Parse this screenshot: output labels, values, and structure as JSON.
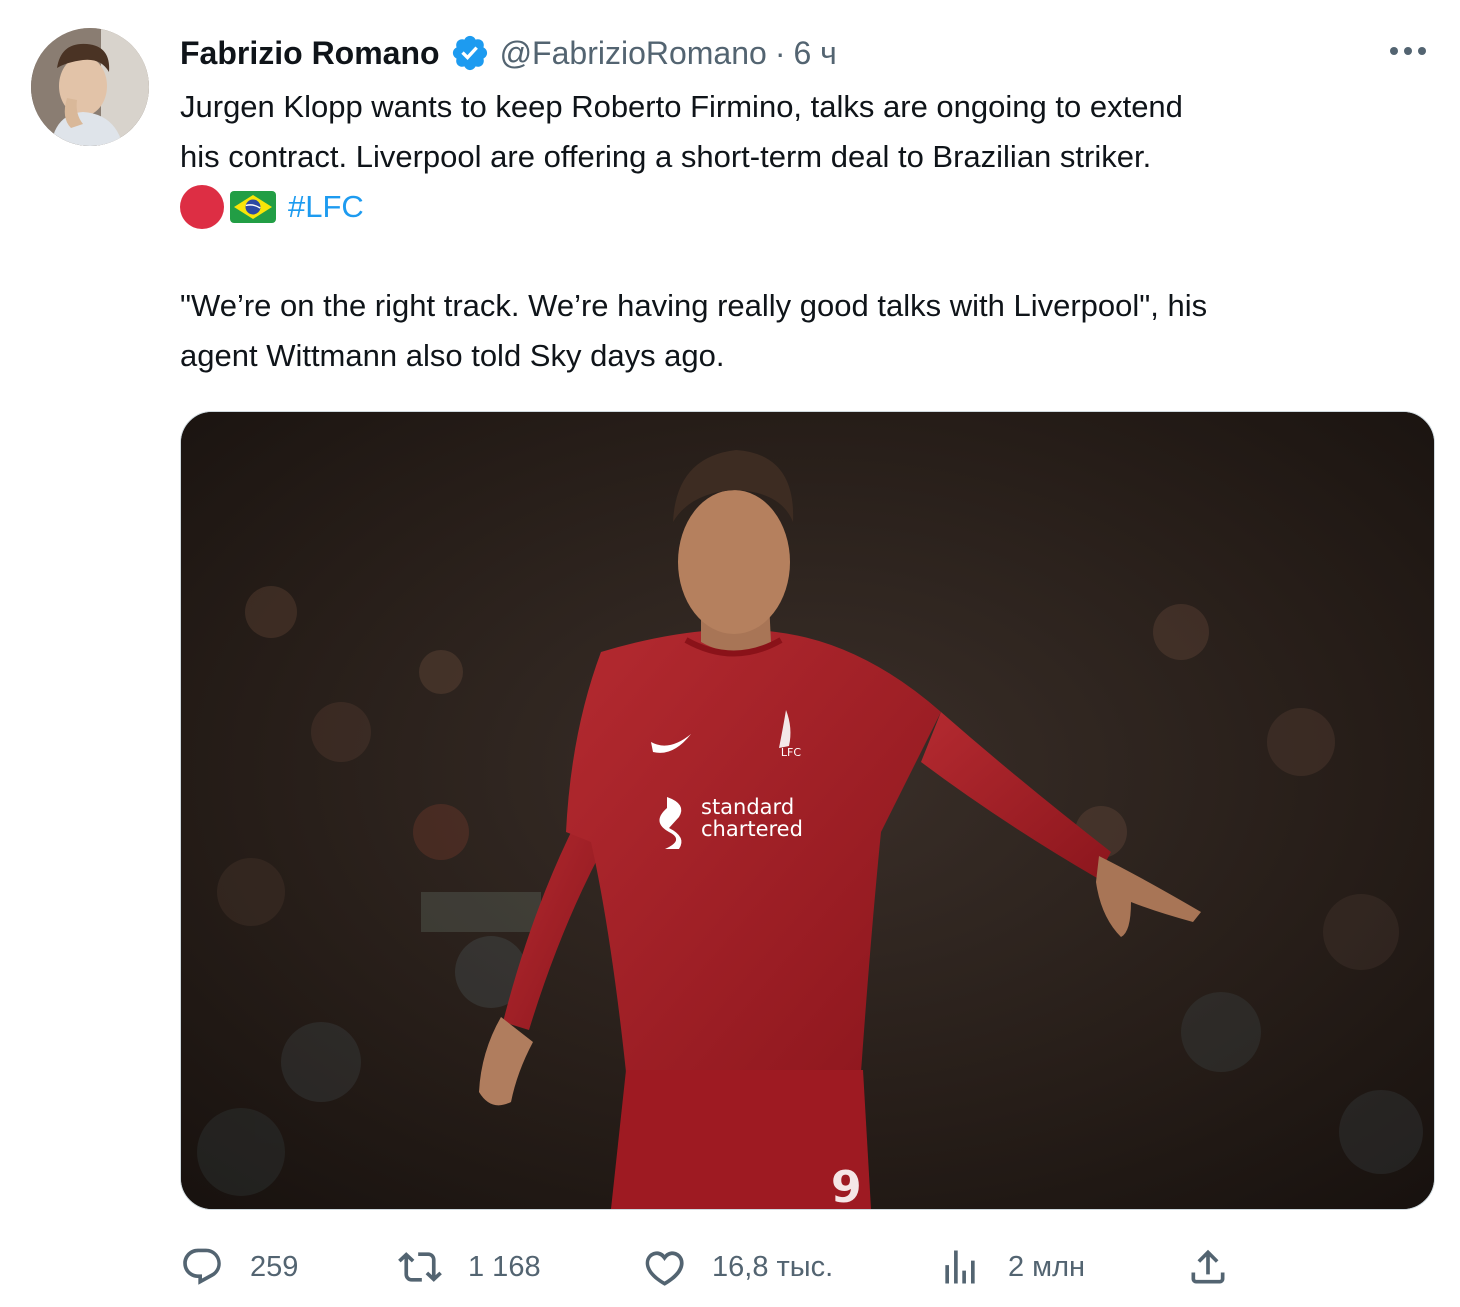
{
  "author": {
    "name": "Fabrizio Romano",
    "handle": "@FabrizioRomano",
    "separator": "·",
    "time": "6 ч"
  },
  "icons": {
    "verified": "verified-badge-icon",
    "more": "more-horizontal-icon",
    "reply": "reply-icon",
    "retweet": "retweet-icon",
    "like": "heart-icon",
    "views": "views-chart-icon",
    "share": "share-icon"
  },
  "tweet": {
    "line1": "Jurgen Klopp wants to keep Roberto Firmino, talks are ongoing to extend",
    "line2": "his contract. Liverpool are offering a short-term deal to Brazilian striker.",
    "hashtag": "#LFC",
    "quote_line1": "\"We’re on the right track. We’re having really good talks with Liverpool\", his",
    "quote_line2": "agent Wittmann also told Sky days ago."
  },
  "image": {
    "sponsor_line1": "standard",
    "sponsor_line2": "chartered",
    "crest_text": "LFC",
    "shirt_number": "9"
  },
  "stats": {
    "replies": "259",
    "retweets": "1 168",
    "likes": "16,8 тыс.",
    "views": "2 млн"
  },
  "colors": {
    "accent": "#1d9bf0",
    "muted": "#536471",
    "text": "#0f1419",
    "emoji_red": "#dd2e44",
    "kit_red": "#a51d24"
  }
}
